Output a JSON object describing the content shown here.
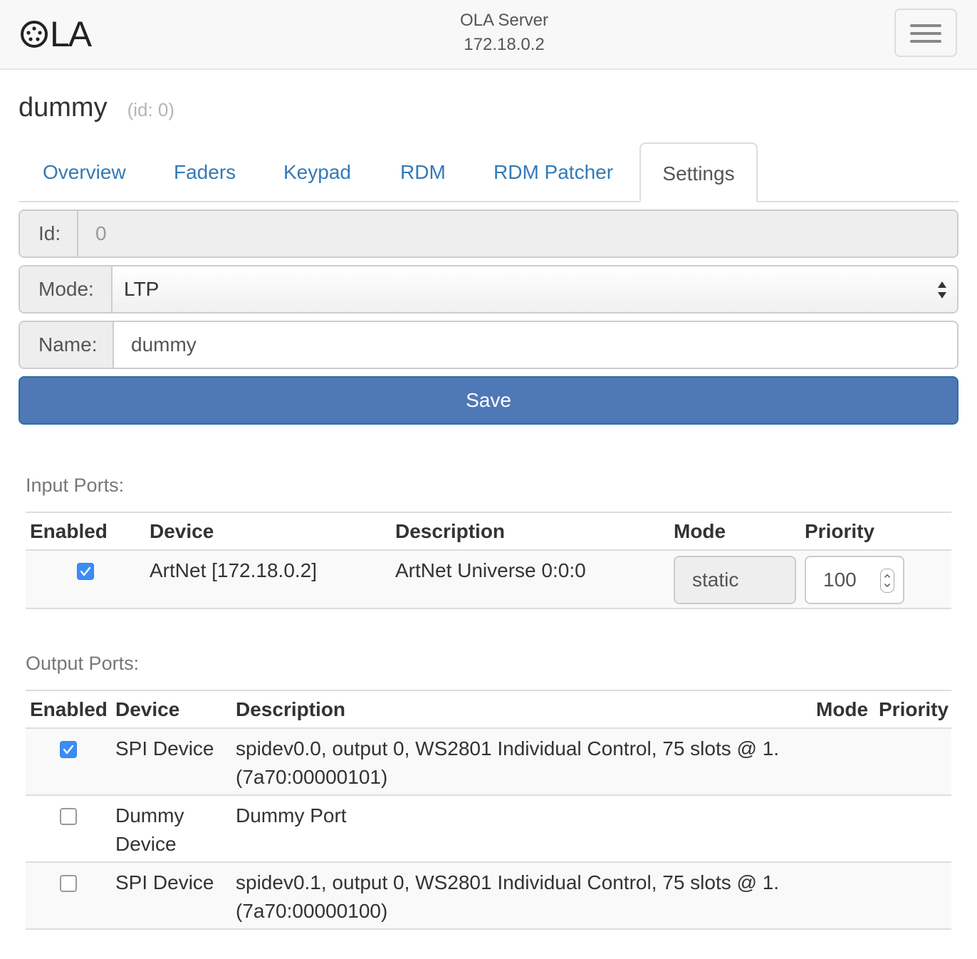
{
  "navbar": {
    "logo_text": "LA",
    "server_title": "OLA Server",
    "server_ip": "172.18.0.2"
  },
  "page": {
    "universe_name": "dummy",
    "universe_id_label": "(id: 0)"
  },
  "tabs": [
    {
      "label": "Overview",
      "active": false
    },
    {
      "label": "Faders",
      "active": false
    },
    {
      "label": "Keypad",
      "active": false
    },
    {
      "label": "RDM",
      "active": false
    },
    {
      "label": "RDM Patcher",
      "active": false
    },
    {
      "label": "Settings",
      "active": true
    }
  ],
  "form": {
    "id_label": "Id:",
    "id_value": "0",
    "mode_label": "Mode:",
    "mode_value": "LTP",
    "name_label": "Name:",
    "name_value": "dummy",
    "save_label": "Save"
  },
  "input_ports": {
    "heading": "Input Ports:",
    "columns": [
      "Enabled",
      "Device",
      "Description",
      "Mode",
      "Priority"
    ],
    "rows": [
      {
        "enabled": true,
        "device": "ArtNet [172.18.0.2]",
        "description": "ArtNet Universe 0:0:0",
        "mode": "static",
        "priority": "100"
      }
    ]
  },
  "output_ports": {
    "heading": "Output Ports:",
    "columns": [
      "Enabled",
      "Device",
      "Description",
      "Mode",
      "Priority"
    ],
    "rows": [
      {
        "enabled": true,
        "device_line1": "SPI Device",
        "device_line2": "",
        "description_line1": "spidev0.0, output 0, WS2801 Individual Control, 75 slots @ 1.",
        "description_line2": "(7a70:00000101)"
      },
      {
        "enabled": false,
        "device_line1": "Dummy",
        "device_line2": "Device",
        "description_line1": "Dummy Port",
        "description_line2": ""
      },
      {
        "enabled": false,
        "device_line1": "SPI Device",
        "device_line2": "",
        "description_line1": "spidev0.1, output 0, WS2801 Individual Control, 75 slots @ 1.",
        "description_line2": "(7a70:00000100)"
      }
    ]
  },
  "colors": {
    "link": "#337ab7",
    "primary_button": "#4f79b6",
    "checkbox_checked": "#3b8cf6"
  },
  "icons": {
    "menu": "hamburger-icon",
    "select_arrows": "up-down-caret-icon",
    "checkbox_checked": "check-icon"
  }
}
